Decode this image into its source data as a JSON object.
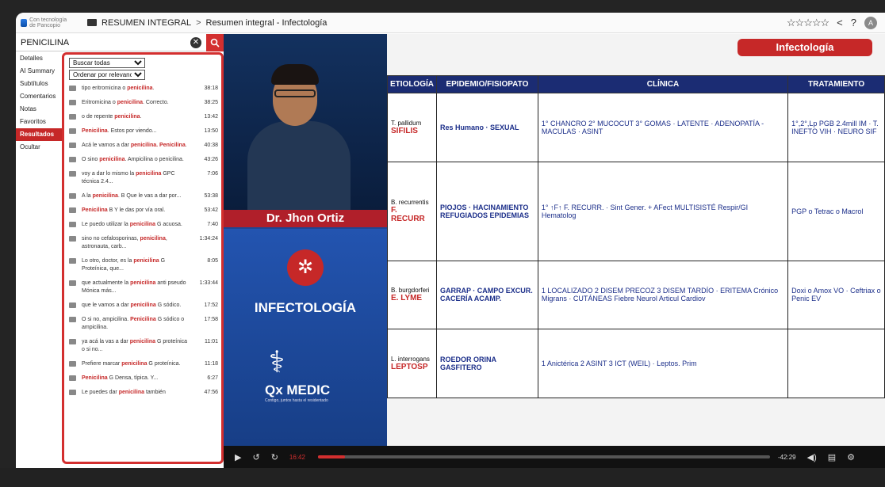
{
  "topbar": {
    "logo_text": "Con tecnología de Pancopio",
    "crumbs": [
      "RESUMEN INTEGRAL",
      "Resumen integral - Infectología"
    ],
    "separator": ">",
    "stars": "☆☆☆☆☆",
    "share_icon": "share-icon",
    "help": "?",
    "avatar": "A"
  },
  "search": {
    "value": "PENICILINA",
    "clear": "✕"
  },
  "leftnav": {
    "items": [
      "Detalles",
      "AI Summary",
      "Subtítulos",
      "Comentarios",
      "Notas",
      "Favoritos",
      "Resultados",
      "Ocultar"
    ]
  },
  "filters": {
    "search_mode": "Buscar todas",
    "sort": "Ordenar por relevancia"
  },
  "results": [
    {
      "pre": "tipo eritromicina o ",
      "hit": "penicilina",
      "post": ".",
      "time": "38:18"
    },
    {
      "pre": "Eritromicina o ",
      "hit": "penicilina",
      "post": ". Correcto.",
      "time": "38:25"
    },
    {
      "pre": "o de repente ",
      "hit": "penicilina",
      "post": ".",
      "time": "13:42"
    },
    {
      "pre": "",
      "hit": "Penicilina",
      "post": ". Estos por viendo...",
      "time": "13:50"
    },
    {
      "pre": "Acá le vamos a dar ",
      "hit": "penicilina. Penicilina",
      "post": ".",
      "time": "40:38"
    },
    {
      "pre": "O sino ",
      "hit": "penicilina",
      "post": ". Ampicilina o penicilina.",
      "time": "43:26"
    },
    {
      "pre": "voy a dar lo mismo la ",
      "hit": "penicilina",
      "post": " GPC técnica 2.4...",
      "time": "7:06"
    },
    {
      "pre": "A la ",
      "hit": "penicilina",
      "post": ". B Que le vas a dar por...",
      "time": "53:38"
    },
    {
      "pre": "",
      "hit": "Penicilina",
      "post": " B Y le das por vía oral.",
      "time": "53:42"
    },
    {
      "pre": "Le puedo utilizar la ",
      "hit": "penicilina",
      "post": " G acuosa.",
      "time": "7:40"
    },
    {
      "pre": "sino no cefalosporinas, ",
      "hit": "penicilina",
      "post": ", astronauta, carb...",
      "time": "1:34:24"
    },
    {
      "pre": "Lo otro, doctor, es la ",
      "hit": "penicilina",
      "post": " G Proteínica, que...",
      "time": "8:05"
    },
    {
      "pre": "que actualmente la ",
      "hit": "penicilina",
      "post": " anti pseudo Mónica más...",
      "time": "1:33:44"
    },
    {
      "pre": "que le vamos a dar ",
      "hit": "penicilina",
      "post": " G sódico.",
      "time": "17:52"
    },
    {
      "pre": "O si no, ampicilina. ",
      "hit": "Penicilina",
      "post": " G sódico o ampicilina.",
      "time": "17:58"
    },
    {
      "pre": "ya acá la vas a dar ",
      "hit": "penicilina",
      "post": " G proteínica o si no...",
      "time": "11:01"
    },
    {
      "pre": "Prefiere marcar ",
      "hit": "penicilina",
      "post": " G proteínica.",
      "time": "11:18"
    },
    {
      "pre": "",
      "hit": "Penicilina",
      "post": " G Densa, típica. Y...",
      "time": "6:27"
    },
    {
      "pre": "Le puedes dar ",
      "hit": "penicilina",
      "post": " también",
      "time": "47:56"
    }
  ],
  "video": {
    "presenter_name": "Dr. Jhon Ortiz",
    "brand_title": "INFECTOLOGÍA",
    "qx_name": "Qx MEDIC",
    "qx_tagline": "Contigo, juntos hasta el residentado",
    "slide_title": "Infectología",
    "watermark": "residentado",
    "table_headers": [
      "ETIOLOGÍA",
      "EPIDEMIO/FISIOPATO",
      "CLÍNICA",
      "TRATAMIENTO"
    ],
    "rows": [
      {
        "etio_label": "T. pallidum",
        "etio_red": "SIFILIS",
        "epi": "Res Humano · SEXUAL",
        "clin": "1° CHANCRO 2° MUCOCUT 3° GOMAS · LATENTE · ADENOPATÍA - MACULAS · ASINT",
        "trat": "1°,2°,Lp PGB 2.4mill IM · T. INEFTO VIH · NEURO SIF"
      },
      {
        "etio_label": "B. recurrentis",
        "etio_red": "F. RECURR",
        "epi": "PIOJOS · HACINAMIENTO REFUGIADOS EPIDEMIAS",
        "clin": "1° ↑F↑ F. RECURR. · Sint Gener. + AFect MULTISISTÉ Respir/GI Hematolog",
        "trat": "PGP o Tetrac o Macrol"
      },
      {
        "etio_label": "B. burgdorferi",
        "etio_red": "E. LYME",
        "epi": "GARRAP · CAMPO EXCUR. CACERÍA ACAMP.",
        "clin": "1 LOCALIZADO 2 DISEM PRECOZ 3 DISEM TARDÍO · ERITEMA Crónico Migrans · CUTÁNEAS Fiebre Neurol Articul Cardiov",
        "trat": "Doxi o Amox VO · Ceftriax o Penic EV"
      },
      {
        "etio_label": "L. interrogans",
        "etio_red": "LEPTOSP",
        "epi": "ROEDOR ORINA GASFITERO",
        "clin": "1 Anictérica 2 ASINT 3 ICT (WEIL) · Leptos. Prim",
        "trat": ""
      }
    ],
    "current_time": "16:42",
    "remaining_time": "-42:29",
    "progress": 0.06
  }
}
